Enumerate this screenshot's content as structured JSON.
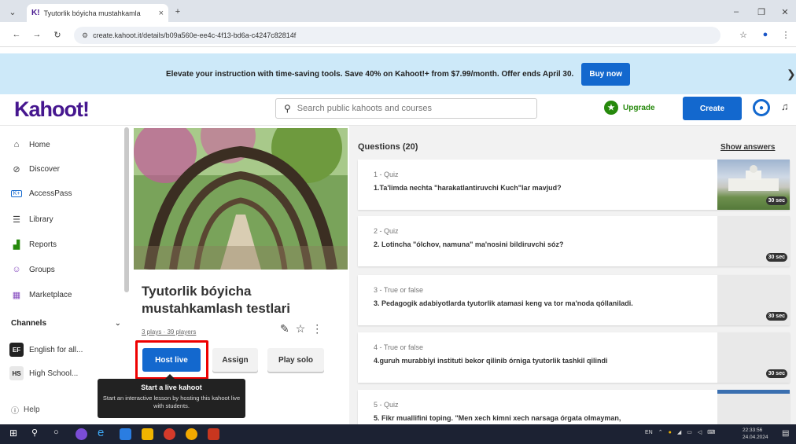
{
  "browser": {
    "tab_title": "Tyutorlik bóyicha mustahkamla",
    "url": "create.kahoot.it/details/b09a560e-ee4c-4f13-bd6a-c4247c82814f"
  },
  "banner": {
    "text": "Elevate your instruction with time-saving tools. Save 40% on Kahoot!+ from $7.99/month. Offer ends April 30.",
    "button": "Buy now"
  },
  "header": {
    "logo": "Kahoot!",
    "search_placeholder": "Search public kahoots and courses",
    "upgrade": "Upgrade",
    "create": "Create"
  },
  "sidebar": {
    "items": [
      {
        "label": "Home",
        "icon": "home-icon"
      },
      {
        "label": "Discover",
        "icon": "compass-icon"
      },
      {
        "label": "AccessPass",
        "icon": "accesspass-icon"
      },
      {
        "label": "Library",
        "icon": "list-icon"
      },
      {
        "label": "Reports",
        "icon": "bar-chart-icon"
      },
      {
        "label": "Groups",
        "icon": "people-icon"
      },
      {
        "label": "Marketplace",
        "icon": "store-icon"
      }
    ],
    "channels_title": "Channels",
    "channels": [
      {
        "badge": "EF",
        "label": "English for all..."
      },
      {
        "badge": "HS",
        "label": "High School..."
      }
    ],
    "help": "Help"
  },
  "kahoot": {
    "title": "Tyutorlik bóyicha mustahkamlash testlari",
    "stats": "3 plays · 39 players",
    "host_live": "Host live",
    "assign": "Assign",
    "play_solo": "Play solo",
    "tooltip_title": "Start a live kahoot",
    "tooltip_text": "Start an interactive lesson by hosting this kahoot live with students."
  },
  "questions": {
    "heading": "Questions (20)",
    "show_answers": "Show answers",
    "items": [
      {
        "type": "1 - Quiz",
        "text": "1.Ta'limda nechta \"harakatlantiruvchi Kuch\"lar mavjud?",
        "time": "30 sec"
      },
      {
        "type": "2 - Quiz",
        "text": "2. Lotincha \"ólchov, namuna\" ma'nosini bildiruvchi sóz?",
        "time": "30 sec"
      },
      {
        "type": "3 - True or false",
        "text": "3. Pedagogik adabiyotlarda tyutorlik atamasi keng va tor ma'noda qóllaniladi.",
        "time": "30 sec"
      },
      {
        "type": "4 - True or false",
        "text": "4.guruh murabbiyi instituti bekor qilinib órniga tyutorlik tashkil qilindi",
        "time": "30 sec"
      },
      {
        "type": "5 - Quiz",
        "text": "5. Fikr muallifini toping. \"Men xech kimni xech narsaga órgata olmayman,",
        "time": ""
      }
    ]
  },
  "taskbar": {
    "lang": "EN",
    "time": "22:33:56",
    "date": "24.04.2024"
  }
}
